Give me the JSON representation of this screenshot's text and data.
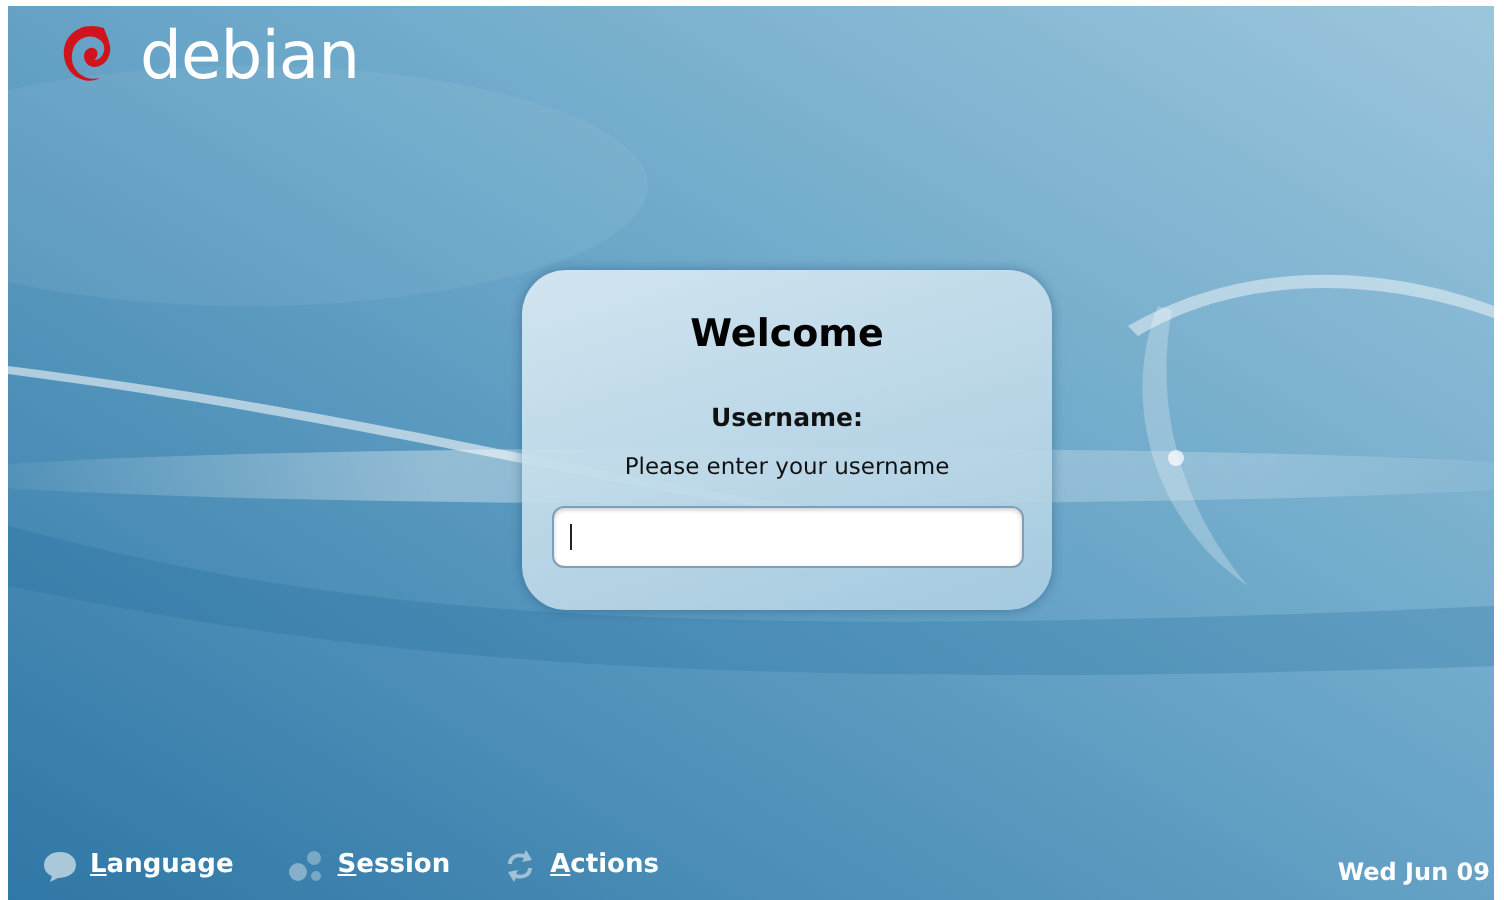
{
  "logo": {
    "text": "debian"
  },
  "login_dialog": {
    "title": "Welcome",
    "field_label": "Username:",
    "prompt": "Please enter your username",
    "username": {
      "focused": true
    }
  },
  "bottom_bar": {
    "items": [
      {
        "kind": "language",
        "label": "Language"
      },
      {
        "kind": "session",
        "label": "Session"
      },
      {
        "kind": "actions",
        "label": "Actions"
      }
    ],
    "clock": "Wed Jun 09"
  }
}
